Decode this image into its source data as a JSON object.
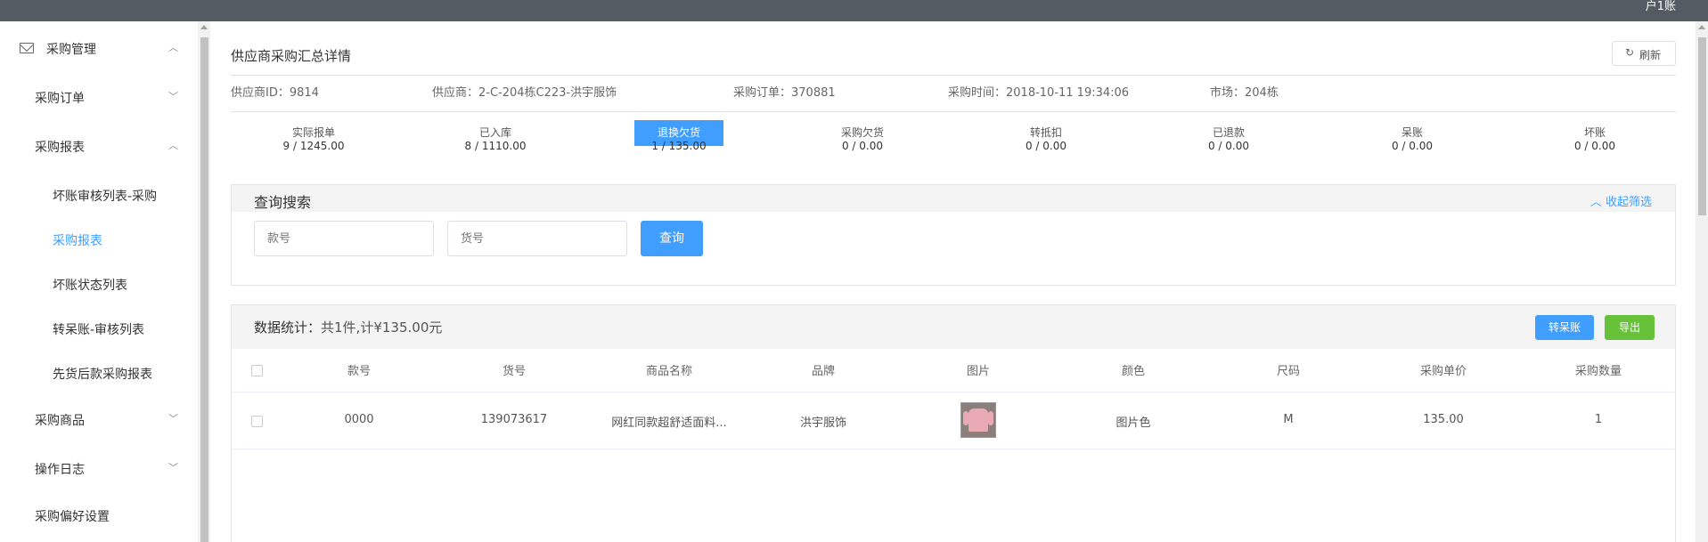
{
  "topbar": {
    "user_label": "户1账"
  },
  "sidebar": {
    "items": [
      {
        "label": "采购管理",
        "chevron": "︿"
      },
      {
        "label": "采购订单",
        "chevron": "﹀"
      },
      {
        "label": "采购报表",
        "chevron": "︿"
      },
      {
        "label": "坏账审核列表-采购"
      },
      {
        "label": "采购报表"
      },
      {
        "label": "坏账状态列表"
      },
      {
        "label": "转呆账-审核列表"
      },
      {
        "label": "先货后款采购报表"
      },
      {
        "label": "采购商品",
        "chevron": "﹀"
      },
      {
        "label": "操作日志",
        "chevron": "﹀"
      },
      {
        "label": "采购偏好设置"
      }
    ],
    "active_color": "#409eff"
  },
  "header": {
    "title": "供应商采购汇总详情",
    "refresh_label": "刷新",
    "refresh_icon": "↻"
  },
  "info": {
    "supplier_id": "供应商ID：9814",
    "supplier": "供应商：2-C-204栋C223-洪宇服饰",
    "order": "采购订单：370881",
    "time": "采购时间：2018-10-11 19:34:06",
    "market": "市场：204栋"
  },
  "stats": [
    {
      "label": "实际报单",
      "value": "9 / 1245.00"
    },
    {
      "label": "已入库",
      "value": "8 / 1110.00"
    },
    {
      "label": "退换欠货",
      "value": "1 / 135.00"
    },
    {
      "label": "采购欠货",
      "value": "0 / 0.00"
    },
    {
      "label": "转抵扣",
      "value": "0 / 0.00"
    },
    {
      "label": "已退款",
      "value": "0 / 0.00"
    },
    {
      "label": "呆账",
      "value": "0 / 0.00"
    },
    {
      "label": "坏账",
      "value": "0 / 0.00"
    }
  ],
  "search": {
    "title": "查询搜索",
    "collapse_label": "︿ 收起筛选",
    "style_placeholder": "款号",
    "sku_placeholder": "货号",
    "query_label": "查询"
  },
  "data": {
    "title": "数据统计：",
    "summary": "共1件,计¥135.00元",
    "transfer_label": "转呆账",
    "export_label": "导出",
    "columns": [
      "款号",
      "货号",
      "商品名称",
      "品牌",
      "图片",
      "颜色",
      "尺码",
      "采购单价",
      "采购数量"
    ],
    "rows": [
      {
        "style_no": "0000",
        "sku": "139073617",
        "name": "网红同款超舒适面料...",
        "brand": "洪宇服饰",
        "color": "图片色",
        "size": "M",
        "price": "135.00",
        "qty": "1"
      }
    ]
  },
  "colors": {
    "topbar": "#555b62",
    "accent": "#409eff",
    "success": "#67c23a"
  }
}
